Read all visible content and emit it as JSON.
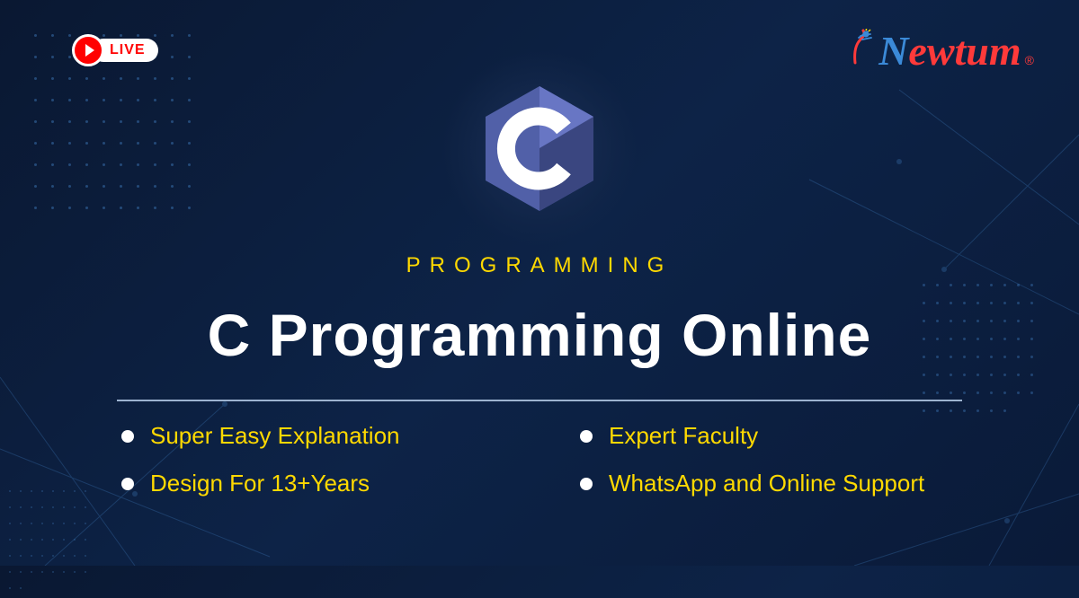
{
  "badge": {
    "live_text": "LIVE"
  },
  "brand": {
    "name_first": "N",
    "name_rest": "ewtum",
    "trademark": "®"
  },
  "hero": {
    "subtitle": "PROGRAMMING",
    "title": "C Programming Online",
    "logo_letter": "C"
  },
  "features": [
    "Super Easy Explanation",
    "Expert Faculty",
    "Design For 13+Years",
    "WhatsApp and Online Support"
  ],
  "colors": {
    "accent_yellow": "#ffd900",
    "brand_blue": "#3b8ad8",
    "brand_red": "#ff3a3a",
    "live_red": "#ff0000"
  }
}
